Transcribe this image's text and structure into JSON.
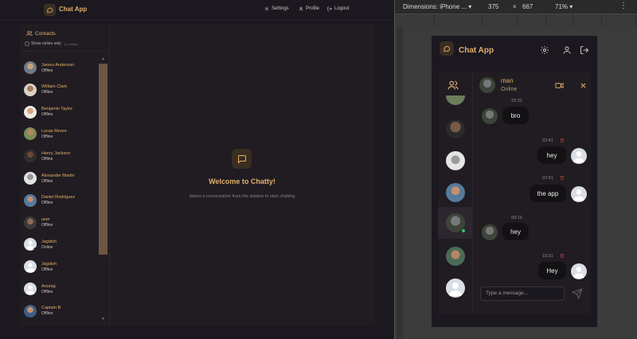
{
  "desktop": {
    "app_title": "Chat App",
    "nav": {
      "settings": "Settings",
      "profile": "Profile",
      "logout": "Logout"
    },
    "sidebar": {
      "title": "Contacts",
      "online_only": "Show online only",
      "online_count": "(1 online)",
      "contacts": [
        {
          "name": "James Anderson",
          "status": "Offline"
        },
        {
          "name": "William Clark",
          "status": "Offline"
        },
        {
          "name": "Benjamin Taylor",
          "status": "Offline"
        },
        {
          "name": "Lucas Moore",
          "status": "Offline"
        },
        {
          "name": "Henry Jackson",
          "status": "Offline"
        },
        {
          "name": "Alexander Martin",
          "status": "Offline"
        },
        {
          "name": "Daniel Rodriguez",
          "status": "Offline"
        },
        {
          "name": "user",
          "status": "Offline"
        },
        {
          "name": "Jagdish",
          "status": "Online"
        },
        {
          "name": "Jagdish",
          "status": "Offline"
        },
        {
          "name": "Anurag",
          "status": "Offline"
        },
        {
          "name": "Captain B",
          "status": "Offline"
        }
      ]
    },
    "welcome": {
      "title": "Welcome to Chatty!",
      "subtitle": "Select a conversation from the sidebar to start chatting"
    }
  },
  "devtools": {
    "dimensions_label": "Dimensions: iPhone ...",
    "width": "375",
    "times": "×",
    "height": "667",
    "zoom": "71%",
    "menu": "⋮"
  },
  "phone": {
    "app_title": "Chat App",
    "chat": {
      "name": "man",
      "status": "Online",
      "input_placeholder": "Type a message...",
      "messages": [
        {
          "time": "22:32",
          "text": "bro",
          "side": "left"
        },
        {
          "time": "22:41",
          "text": "hey",
          "side": "right"
        },
        {
          "time": "22:41",
          "text": "the app",
          "side": "right"
        },
        {
          "time": "09:16",
          "text": "hey",
          "side": "left"
        },
        {
          "time": "19:31",
          "text": "Hey",
          "side": "right"
        }
      ]
    }
  },
  "colors": {
    "accent": "#e1b069",
    "bg": "#1b1820",
    "bubble": "#131114",
    "online": "#2fc56b"
  }
}
